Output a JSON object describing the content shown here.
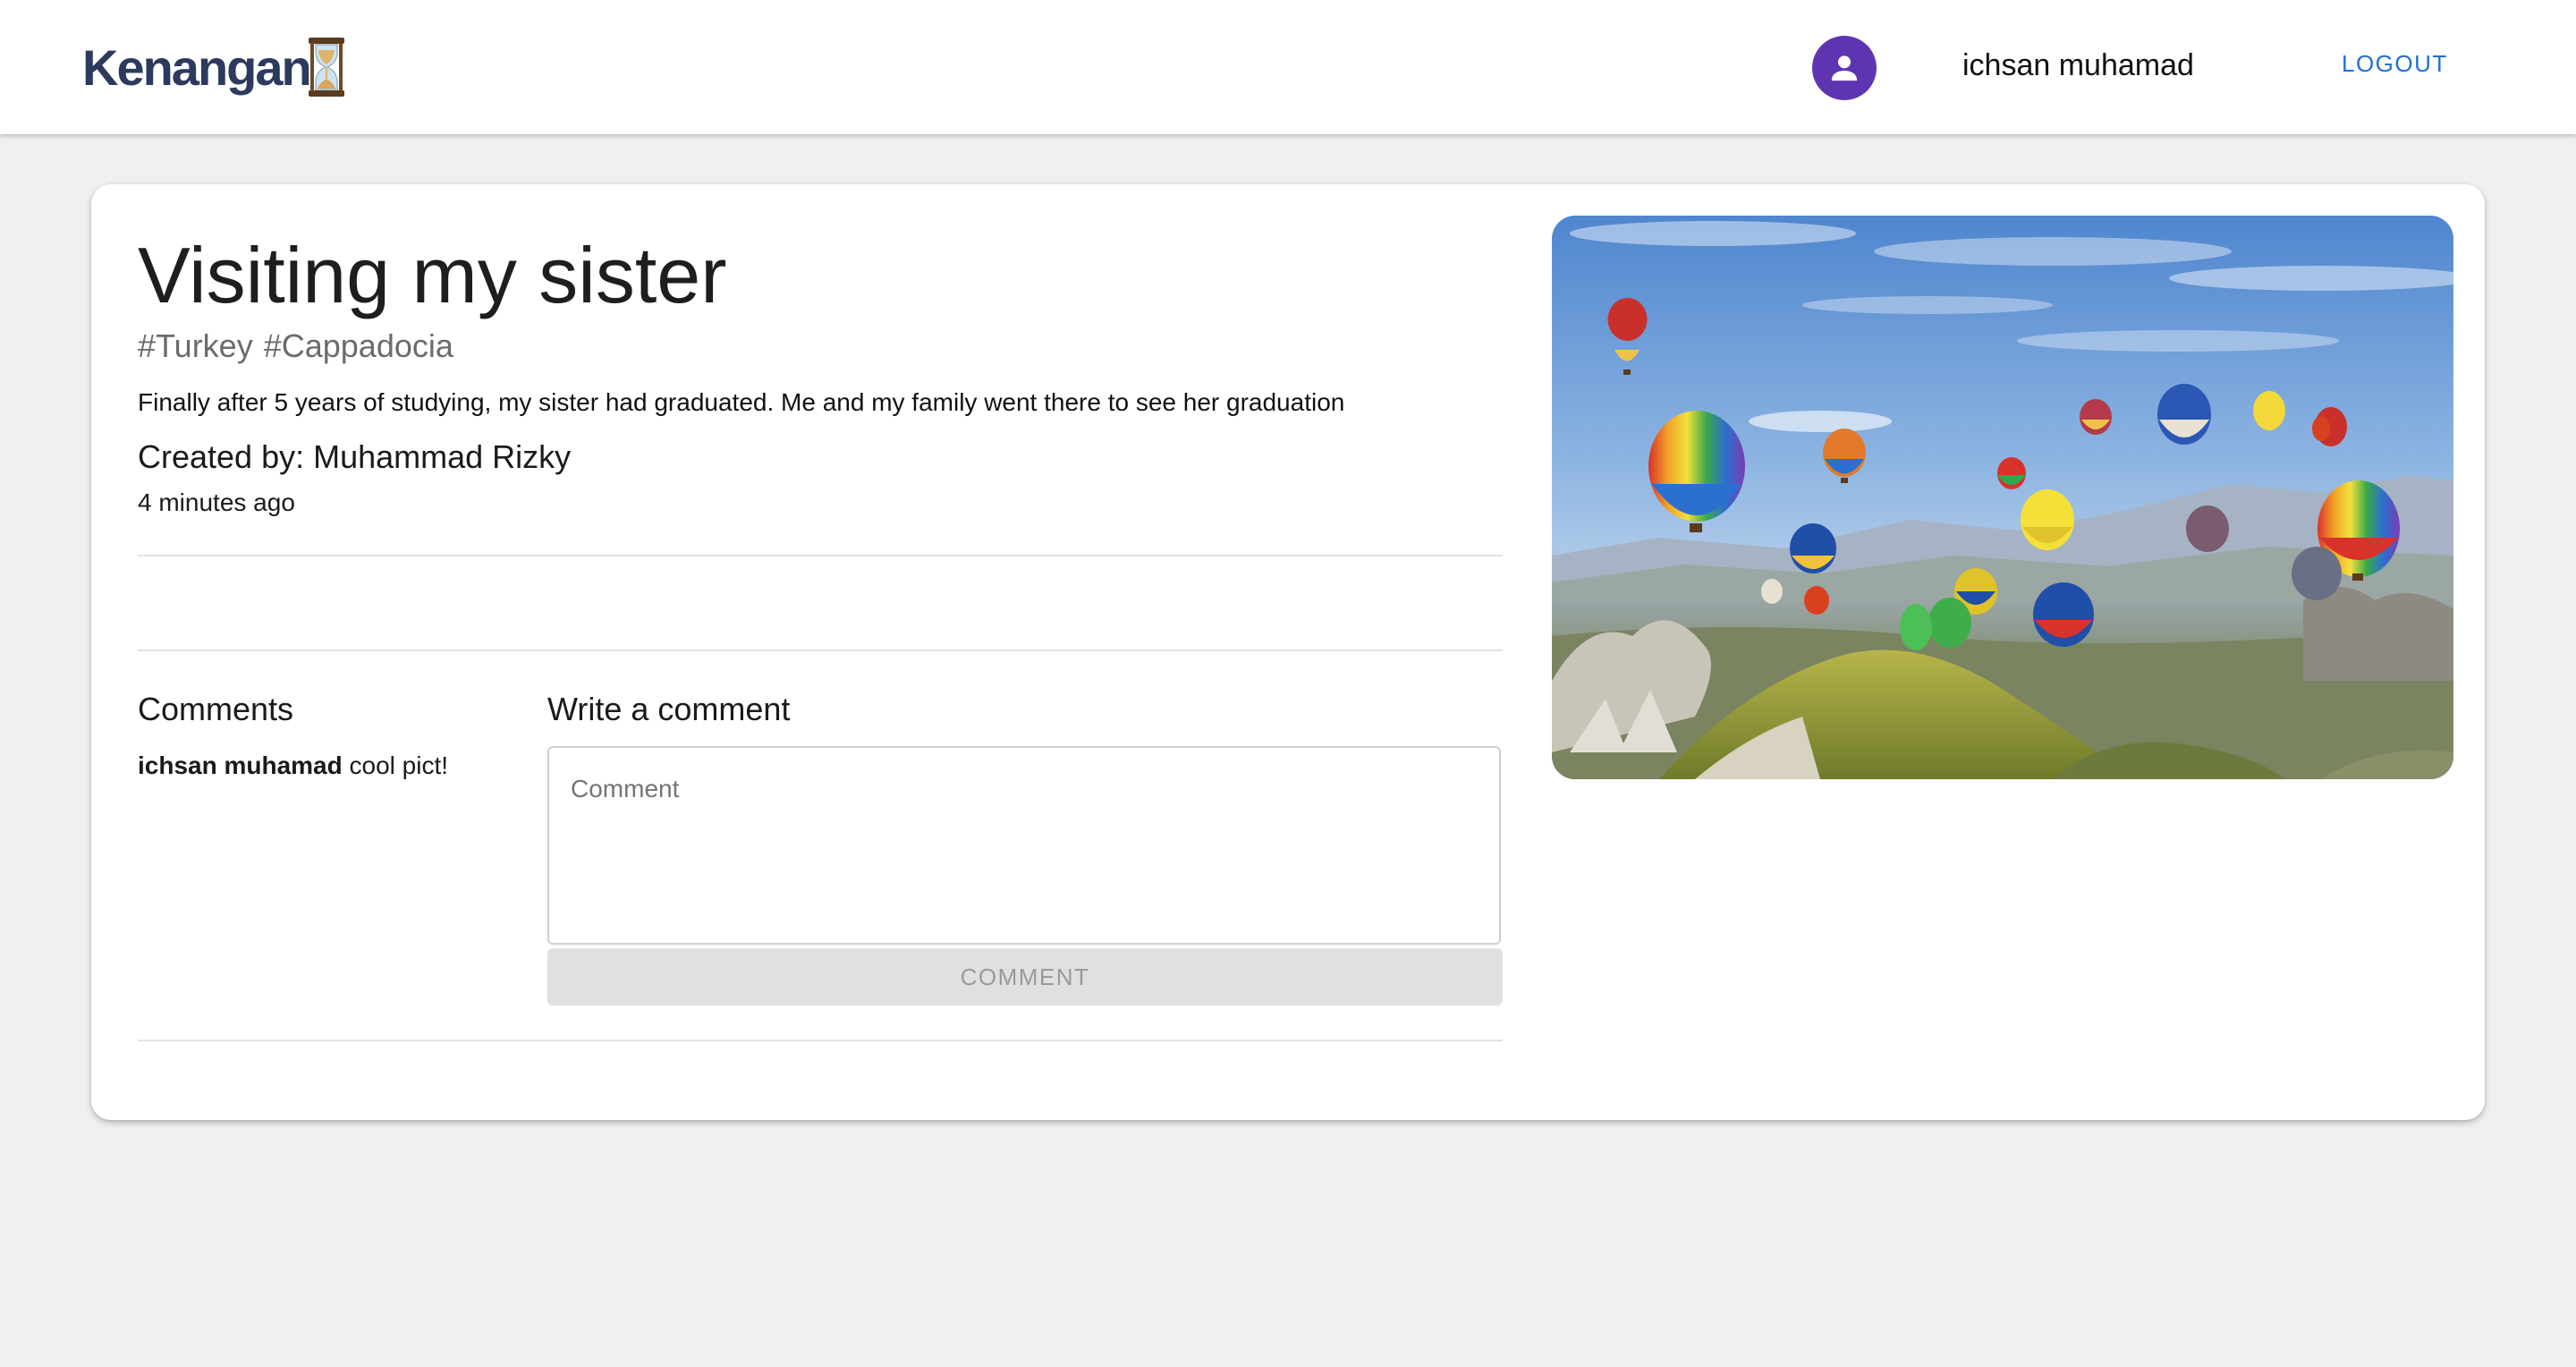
{
  "header": {
    "brand": "Kenangan",
    "user_name": "ichsan muhamad",
    "logout_label": "LOGOUT"
  },
  "memory": {
    "title": "Visiting my sister",
    "tags": [
      "#Turkey",
      "#Cappadocia"
    ],
    "message": "Finally after 5 years of studying, my sister had graduated. Me and my family went there to see her graduation",
    "created_by": "Created by: Muhammad Rizky",
    "time_ago": "4 minutes ago"
  },
  "comments": {
    "heading": "Comments",
    "items": [
      {
        "author": "ichsan muhamad",
        "text": "cool pict!"
      }
    ]
  },
  "write_comment": {
    "heading": "Write a comment",
    "placeholder": "Comment",
    "button_label": "COMMENT"
  },
  "colors": {
    "brand": "#2c3a5e",
    "avatar": "#5e35b1",
    "link": "#1f6fd6",
    "background": "#f0f0f0"
  }
}
